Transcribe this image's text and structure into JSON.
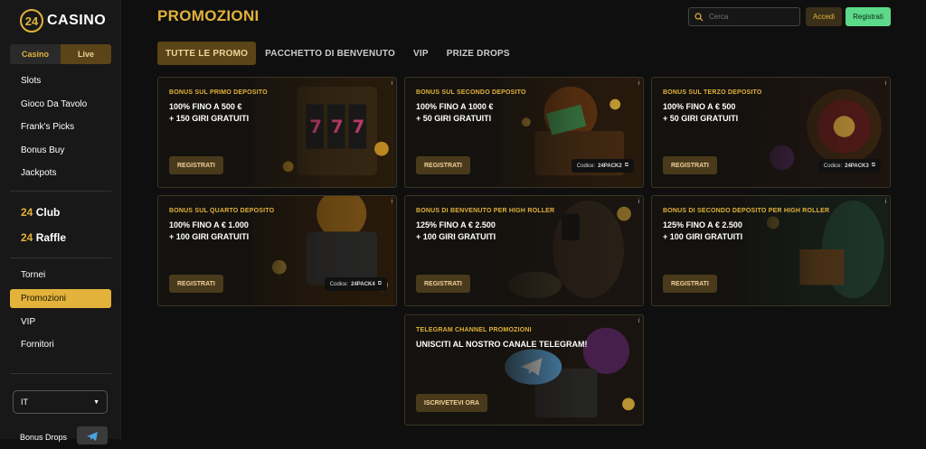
{
  "logo": {
    "number": "24",
    "text": "CASINO"
  },
  "sidebar": {
    "toggle": {
      "casino": "Casino",
      "live": "Live"
    },
    "items": [
      "Slots",
      "Gioco Da Tavolo",
      "Frank's Picks",
      "Bonus Buy",
      "Jackpots"
    ],
    "club": {
      "num": "24",
      "label": "Club"
    },
    "raffle": {
      "num": "24",
      "label": "Raffle"
    },
    "items2": [
      "Tornei",
      "Promozioni",
      "VIP",
      "Fornitori"
    ],
    "active_item": "Promozioni",
    "language": "IT",
    "bonus_drops": "Bonus Drops"
  },
  "header": {
    "title": "PROMOZIONI",
    "search_placeholder": "Cerca",
    "login": "Accedi",
    "register": "Registrati"
  },
  "tabs": [
    "TUTTE LE PROMO",
    "PACCHETTO DI BENVENUTO",
    "VIP",
    "PRIZE DROPS"
  ],
  "cards": [
    {
      "title": "BONUS SUL PRIMO DEPOSITO",
      "line1": "100% FINO A 500 €",
      "line2": "+ 150 GIRI GRATUITI",
      "button": "REGISTRATI",
      "code_label": "",
      "code": ""
    },
    {
      "title": "BONUS SUL SECONDO DEPOSITO",
      "line1": "100% FINO A 1000 €",
      "line2": "+ 50 GIRI GRATUITI",
      "button": "REGISTRATI",
      "code_label": "Codice:",
      "code": "24PACK2"
    },
    {
      "title": "BONUS SUL TERZO DEPOSITO",
      "line1": "100% FINO A € 500",
      "line2": "+ 50 GIRI GRATUITI",
      "button": "REGISTRATI",
      "code_label": "Codice:",
      "code": "24PACK3"
    },
    {
      "title": "BONUS SUL QUARTO DEPOSITO",
      "line1": "100% FINO A € 1.000",
      "line2": "+ 100 GIRI GRATUITI",
      "button": "REGISTRATI",
      "code_label": "Codice:",
      "code": "24PACK4"
    },
    {
      "title": "BONUS DI BENVENUTO PER HIGH ROLLER",
      "line1": "125% FINO A € 2.500",
      "line2": "+ 100 GIRI GRATUITI",
      "button": "REGISTRATI",
      "code_label": "",
      "code": ""
    },
    {
      "title": "BONUS DI SECONDO DEPOSITO PER HIGH ROLLER",
      "line1": "125% FINO A € 2.500",
      "line2": "+ 100 GIRI GRATUITI",
      "button": "REGISTRATI",
      "code_label": "",
      "code": ""
    },
    {
      "title": "TELEGRAM CHANNEL PROMOZIONI",
      "line1": "UNISCITI AL NOSTRO CANALE TELEGRAM!",
      "line2": "",
      "button": "ISCRIVETEVI ORA",
      "code_label": "",
      "code": ""
    }
  ],
  "info_icon": "i",
  "colors": {
    "accent": "#e2b23a",
    "register": "#5dd98a"
  }
}
